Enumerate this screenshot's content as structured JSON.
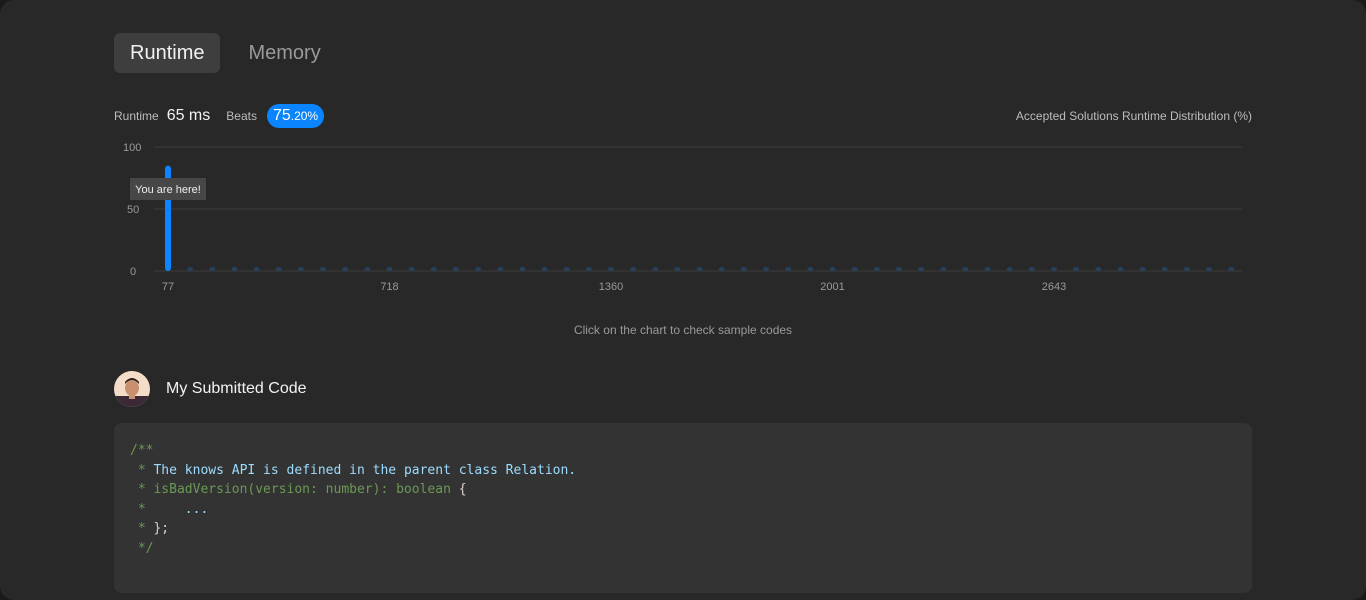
{
  "tabs": [
    {
      "label": "Runtime",
      "active": true
    },
    {
      "label": "Memory",
      "active": false
    }
  ],
  "stats": {
    "runtime_label": "Runtime",
    "runtime_value": "65 ms",
    "beats_label": "Beats",
    "beats_int": "75",
    "beats_dec": ".20%"
  },
  "chart_title": "Accepted Solutions Runtime Distribution (%)",
  "chart_data": {
    "type": "bar",
    "ylim": [
      0,
      100
    ],
    "yticks": [
      "100",
      "50",
      "0"
    ],
    "x_tick_labels": [
      "77",
      "718",
      "1360",
      "2001",
      "2643"
    ],
    "highlight_bar_index": 0,
    "highlight_value": 85,
    "bar_count": 49,
    "values": [
      85,
      1,
      1,
      1,
      1,
      1,
      1,
      1,
      1,
      1,
      1,
      1,
      1,
      1,
      1,
      1,
      1,
      1,
      1,
      1,
      1,
      1,
      1,
      1,
      1,
      1,
      1,
      1,
      1,
      1,
      1,
      1,
      1,
      1,
      1,
      1,
      1,
      1,
      1,
      1,
      1,
      1,
      1,
      1,
      1,
      1,
      1,
      1,
      1
    ],
    "tooltip": "You are here!",
    "colors": {
      "highlight": "#0a84ff",
      "bars": "#26405e",
      "grid": "#3c3c3c"
    }
  },
  "hint": "Click on the chart to check sample codes",
  "submission": {
    "title": "My Submitted Code"
  },
  "code_lines": [
    [
      {
        "t": "/**",
        "c": "cmt"
      }
    ],
    [
      {
        "t": " * ",
        "c": "cmt"
      },
      {
        "t": "The knows API is defined in the parent class Relation.",
        "c": "doc"
      }
    ],
    [
      {
        "t": " * isBadVersion(version: number): boolean ",
        "c": "cmt"
      },
      {
        "t": "{",
        "c": "plain"
      }
    ],
    [
      {
        "t": " *     ",
        "c": "cmt"
      },
      {
        "t": "...",
        "c": "doc"
      }
    ],
    [
      {
        "t": " * ",
        "c": "cmt"
      },
      {
        "t": "};",
        "c": "plain"
      }
    ],
    [
      {
        "t": " */",
        "c": "cmt"
      }
    ]
  ]
}
